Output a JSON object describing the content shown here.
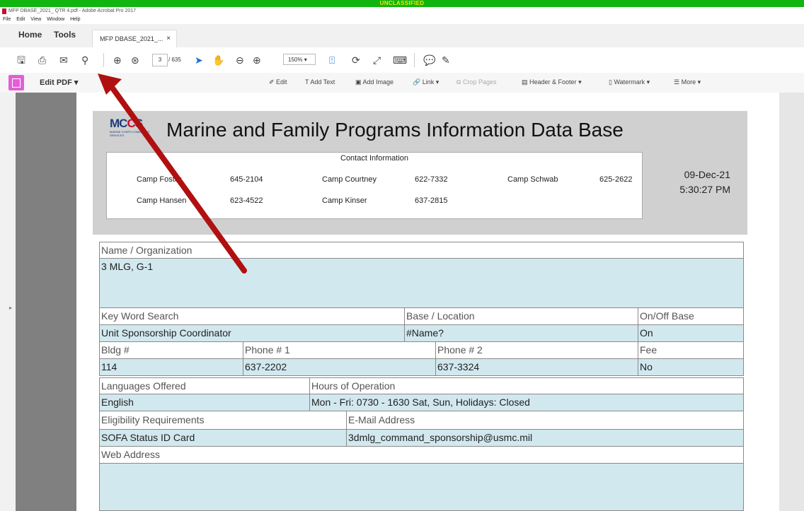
{
  "banner": "UNCLASSIFIED",
  "window": {
    "title": "MFP DBASE_2021_ QTR 4.pdf - Adobe Acrobat Pro 2017"
  },
  "menu": [
    "File",
    "Edit",
    "View",
    "Window",
    "Help"
  ],
  "nav": {
    "home": "Home",
    "tools": "Tools",
    "doc_tab": "MFP DBASE_2021_...",
    "close": "×"
  },
  "toolbar": {
    "page_current": "3",
    "page_total": "/ 635",
    "zoom": "150%"
  },
  "edit_toolbar": {
    "label": "Edit PDF",
    "tools": [
      {
        "label": "Edit"
      },
      {
        "label": "Add Text"
      },
      {
        "label": "Add Image"
      },
      {
        "label": "Link"
      },
      {
        "label": "Crop Pages"
      },
      {
        "label": "Header & Footer"
      },
      {
        "label": "Watermark"
      },
      {
        "label": "More"
      }
    ]
  },
  "doc": {
    "logo": {
      "text_m": "MC",
      "text_c": "C",
      "text_s": "S",
      "tagline": "MARINE CORPS COMMUNITY SERVICES"
    },
    "title": "Marine and Family Programs Information Data Base",
    "contact": {
      "title": "Contact Information",
      "entries": [
        {
          "name": "Camp Foster",
          "phone": "645-2104"
        },
        {
          "name": "Camp Courtney",
          "phone": "622-7332"
        },
        {
          "name": "Camp Schwab",
          "phone": "625-2622"
        },
        {
          "name": "Camp Hansen",
          "phone": "623-4522"
        },
        {
          "name": "Camp Kinser",
          "phone": "637-2815"
        }
      ]
    },
    "date": "09-Dec-21",
    "time": "5:30:27 PM",
    "fields": {
      "name_label": "Name / Organization",
      "name_value": "3 MLG, G-1",
      "keyword_label": "Key Word Search",
      "base_label": "Base / Location",
      "onoff_label": "On/Off Base",
      "keyword_value": "Unit Sponsorship Coordinator",
      "base_value": "#Name?",
      "onoff_value": "On",
      "bldg_label": "Bldg #",
      "phone1_label": "Phone # 1",
      "phone2_label": "Phone # 2",
      "fee_label": "Fee",
      "bldg_value": "114",
      "phone1_value": "637-2202",
      "phone2_value": "637-3324",
      "fee_value": "No",
      "lang_label": "Languages Offered",
      "hours_label": "Hours of Operation",
      "lang_value": "English",
      "hours_value": "Mon - Fri: 0730 - 1630  Sat, Sun, Holidays: Closed",
      "elig_label": "Eligibility Requirements",
      "email_label": "E-Mail Address",
      "elig_value": "SOFA Status ID Card",
      "email_value": "3dmlg_command_sponsorship@usmc.mil",
      "web_label": "Web Address",
      "web_value": ""
    }
  },
  "colors": {
    "banner": "#10b510",
    "banner_text": "#f4e40a",
    "field_bg": "#d2e8ef",
    "header_bg": "#d0d0d0",
    "arrow": "#b01010",
    "edit_icon": "#e35fd4"
  }
}
